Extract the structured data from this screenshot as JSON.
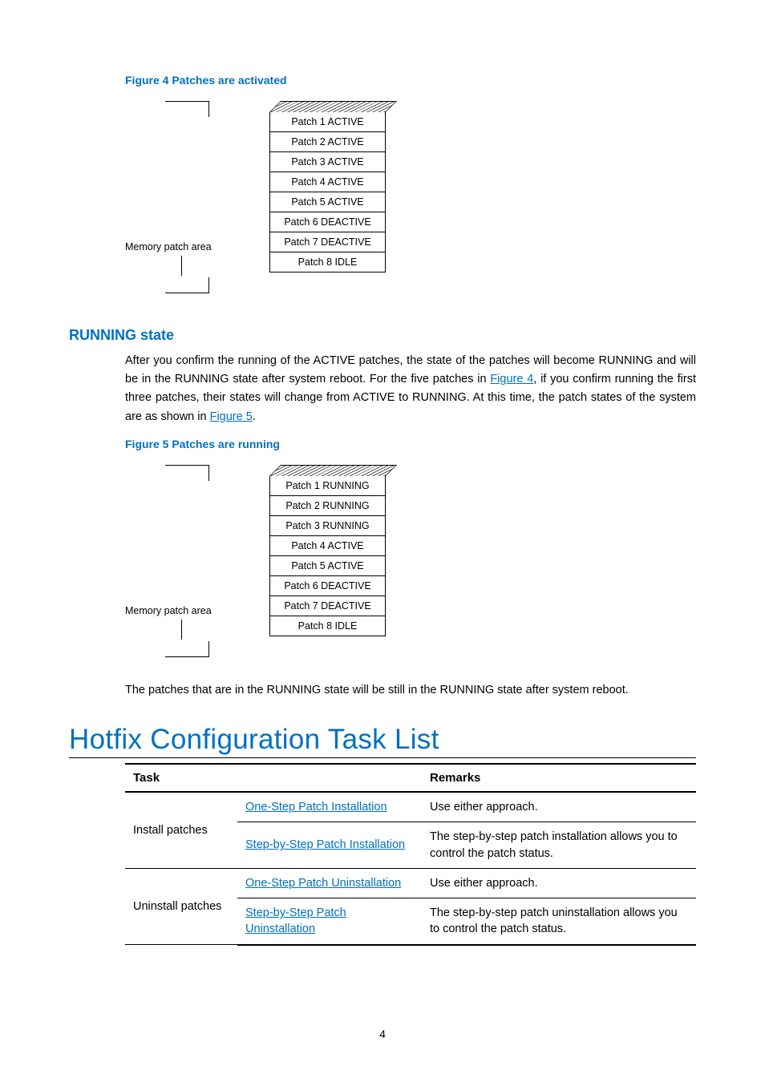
{
  "figure4": {
    "caption": "Figure 4 Patches are activated",
    "memlabel": "Memory patch area",
    "patches": [
      "Patch 1 ACTIVE",
      "Patch 2 ACTIVE",
      "Patch 3 ACTIVE",
      "Patch 4 ACTIVE",
      "Patch 5 ACTIVE",
      "Patch 6 DEACTIVE",
      "Patch 7 DEACTIVE",
      "Patch 8 IDLE"
    ]
  },
  "running": {
    "heading": "RUNNING state",
    "para_pre": "After you confirm the running of the ACTIVE patches, the state of the patches will become RUNNING and will be in the RUNNING state after system reboot. For the five patches in ",
    "link1": "Figure 4",
    "para_mid": ", if you confirm running the first three patches, their states will change from ACTIVE to RUNNING. At this time, the patch states of the system are as shown in ",
    "link2": "Figure 5",
    "para_end": "."
  },
  "figure5": {
    "caption": "Figure 5 Patches are running",
    "memlabel": "Memory patch area",
    "patches": [
      "Patch 1 RUNNING",
      "Patch 2 RUNNING",
      "Patch 3 RUNNING",
      "Patch 4 ACTIVE",
      "Patch 5 ACTIVE",
      "Patch 6 DEACTIVE",
      "Patch 7 DEACTIVE",
      "Patch 8 IDLE"
    ]
  },
  "reboot_note": "The patches that are in the RUNNING state will be still in the RUNNING state after system reboot.",
  "tasklist": {
    "heading": "Hotfix Configuration Task List",
    "header_task": "Task",
    "header_remarks": "Remarks",
    "rows": {
      "install_label": "Install patches",
      "install_a1": "One-Step Patch Installation",
      "install_r1": "Use either approach.",
      "install_a2": "Step-by-Step Patch Installation",
      "install_r2": "The step-by-step patch installation allows you to control the patch status.",
      "uninstall_label": "Uninstall patches",
      "uninstall_a1": "One-Step Patch Uninstallation",
      "uninstall_r1": "Use either approach.",
      "uninstall_a2": "Step-by-Step Patch Uninstallation",
      "uninstall_r2": "The step-by-step patch uninstallation allows you to control the patch status."
    }
  },
  "page_number": "4"
}
